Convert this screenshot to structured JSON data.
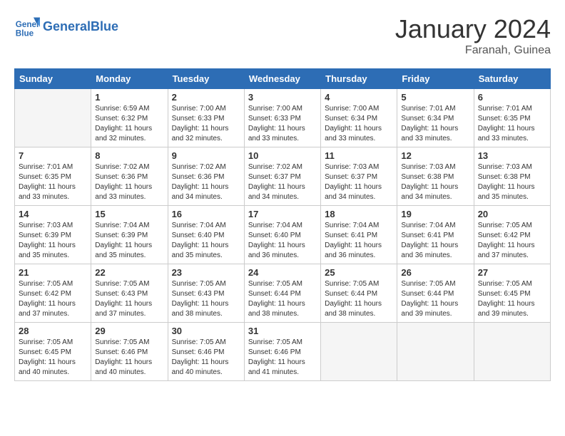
{
  "header": {
    "logo_line1": "General",
    "logo_line2": "Blue",
    "title": "January 2024",
    "subtitle": "Faranah, Guinea"
  },
  "weekdays": [
    "Sunday",
    "Monday",
    "Tuesday",
    "Wednesday",
    "Thursday",
    "Friday",
    "Saturday"
  ],
  "weeks": [
    [
      {
        "day": "",
        "empty": true
      },
      {
        "day": "1",
        "sunrise": "6:59 AM",
        "sunset": "6:32 PM",
        "daylight": "11 hours and 32 minutes."
      },
      {
        "day": "2",
        "sunrise": "7:00 AM",
        "sunset": "6:33 PM",
        "daylight": "11 hours and 32 minutes."
      },
      {
        "day": "3",
        "sunrise": "7:00 AM",
        "sunset": "6:33 PM",
        "daylight": "11 hours and 33 minutes."
      },
      {
        "day": "4",
        "sunrise": "7:00 AM",
        "sunset": "6:34 PM",
        "daylight": "11 hours and 33 minutes."
      },
      {
        "day": "5",
        "sunrise": "7:01 AM",
        "sunset": "6:34 PM",
        "daylight": "11 hours and 33 minutes."
      },
      {
        "day": "6",
        "sunrise": "7:01 AM",
        "sunset": "6:35 PM",
        "daylight": "11 hours and 33 minutes."
      }
    ],
    [
      {
        "day": "7",
        "sunrise": "7:01 AM",
        "sunset": "6:35 PM",
        "daylight": "11 hours and 33 minutes."
      },
      {
        "day": "8",
        "sunrise": "7:02 AM",
        "sunset": "6:36 PM",
        "daylight": "11 hours and 33 minutes."
      },
      {
        "day": "9",
        "sunrise": "7:02 AM",
        "sunset": "6:36 PM",
        "daylight": "11 hours and 34 minutes."
      },
      {
        "day": "10",
        "sunrise": "7:02 AM",
        "sunset": "6:37 PM",
        "daylight": "11 hours and 34 minutes."
      },
      {
        "day": "11",
        "sunrise": "7:03 AM",
        "sunset": "6:37 PM",
        "daylight": "11 hours and 34 minutes."
      },
      {
        "day": "12",
        "sunrise": "7:03 AM",
        "sunset": "6:38 PM",
        "daylight": "11 hours and 34 minutes."
      },
      {
        "day": "13",
        "sunrise": "7:03 AM",
        "sunset": "6:38 PM",
        "daylight": "11 hours and 35 minutes."
      }
    ],
    [
      {
        "day": "14",
        "sunrise": "7:03 AM",
        "sunset": "6:39 PM",
        "daylight": "11 hours and 35 minutes."
      },
      {
        "day": "15",
        "sunrise": "7:04 AM",
        "sunset": "6:39 PM",
        "daylight": "11 hours and 35 minutes."
      },
      {
        "day": "16",
        "sunrise": "7:04 AM",
        "sunset": "6:40 PM",
        "daylight": "11 hours and 35 minutes."
      },
      {
        "day": "17",
        "sunrise": "7:04 AM",
        "sunset": "6:40 PM",
        "daylight": "11 hours and 36 minutes."
      },
      {
        "day": "18",
        "sunrise": "7:04 AM",
        "sunset": "6:41 PM",
        "daylight": "11 hours and 36 minutes."
      },
      {
        "day": "19",
        "sunrise": "7:04 AM",
        "sunset": "6:41 PM",
        "daylight": "11 hours and 36 minutes."
      },
      {
        "day": "20",
        "sunrise": "7:05 AM",
        "sunset": "6:42 PM",
        "daylight": "11 hours and 37 minutes."
      }
    ],
    [
      {
        "day": "21",
        "sunrise": "7:05 AM",
        "sunset": "6:42 PM",
        "daylight": "11 hours and 37 minutes."
      },
      {
        "day": "22",
        "sunrise": "7:05 AM",
        "sunset": "6:43 PM",
        "daylight": "11 hours and 37 minutes."
      },
      {
        "day": "23",
        "sunrise": "7:05 AM",
        "sunset": "6:43 PM",
        "daylight": "11 hours and 38 minutes."
      },
      {
        "day": "24",
        "sunrise": "7:05 AM",
        "sunset": "6:44 PM",
        "daylight": "11 hours and 38 minutes."
      },
      {
        "day": "25",
        "sunrise": "7:05 AM",
        "sunset": "6:44 PM",
        "daylight": "11 hours and 38 minutes."
      },
      {
        "day": "26",
        "sunrise": "7:05 AM",
        "sunset": "6:44 PM",
        "daylight": "11 hours and 39 minutes."
      },
      {
        "day": "27",
        "sunrise": "7:05 AM",
        "sunset": "6:45 PM",
        "daylight": "11 hours and 39 minutes."
      }
    ],
    [
      {
        "day": "28",
        "sunrise": "7:05 AM",
        "sunset": "6:45 PM",
        "daylight": "11 hours and 40 minutes."
      },
      {
        "day": "29",
        "sunrise": "7:05 AM",
        "sunset": "6:46 PM",
        "daylight": "11 hours and 40 minutes."
      },
      {
        "day": "30",
        "sunrise": "7:05 AM",
        "sunset": "6:46 PM",
        "daylight": "11 hours and 40 minutes."
      },
      {
        "day": "31",
        "sunrise": "7:05 AM",
        "sunset": "6:46 PM",
        "daylight": "11 hours and 41 minutes."
      },
      {
        "day": "",
        "empty": true
      },
      {
        "day": "",
        "empty": true
      },
      {
        "day": "",
        "empty": true
      }
    ]
  ]
}
